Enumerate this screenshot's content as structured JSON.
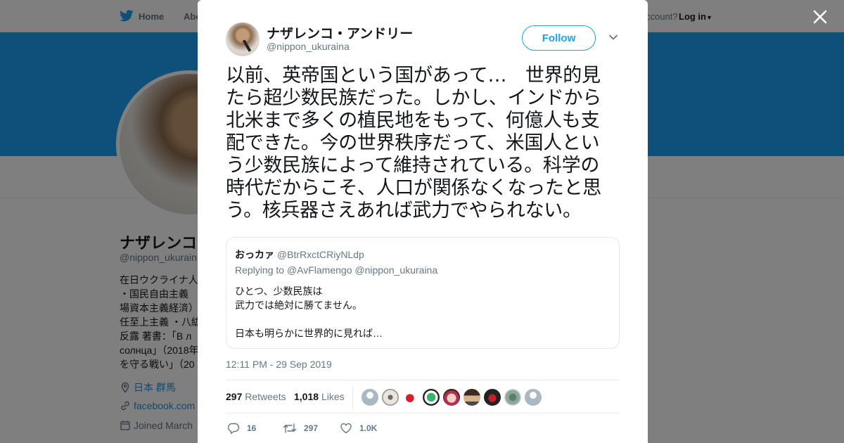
{
  "nav": {
    "home": "Home",
    "about": "Abo",
    "account_prompt": "ccount?",
    "login": "Log in"
  },
  "profile": {
    "name": "ナザレンコ",
    "handle": "@nippon_ukurain",
    "bio_lines": [
      "在日ウクライナ人",
      "・国民自由主義",
      "場資本主義経済）",
      "任至上主義 ・八紘",
      "反露 著書：「В л",
      "солнца」（2018年",
      "を守る戦い」（20"
    ],
    "location": "日本 群馬",
    "url": "facebook.com",
    "joined": "Joined March"
  },
  "tweet": {
    "author_name": "ナザレンコ・アンドリー",
    "author_handle": "@nippon_ukuraina",
    "follow_label": "Follow",
    "text_lines": [
      "以前、英帝国という国があって…　世界的見",
      "たら超少数民族だった。しかし、インドから",
      "北米まで多くの植民地をもって、何億人も支",
      "配できた。今の世界秩序だって、米国人とい",
      "う少数民族によって維持されている。科学の",
      "時代だからこそ、人口が関係なくなったと思",
      "う。核兵器さえあれば武力でやられない。"
    ],
    "quoted": {
      "name": "おっカァ",
      "handle": "@BtrRxctCRiyNLdp",
      "replying_prefix": "Replying to",
      "replying_to": "@AvFlamengo @nippon_ukuraina",
      "body_lines": [
        "ひとつ、少数民族は",
        "武力では絶対に勝てません。",
        "",
        "日本も明らかに世界的に見れば…"
      ]
    },
    "timestamp": "12:11 PM - 29 Sep 2019",
    "retweets_count": "297",
    "retweets_label": "Retweets",
    "likes_count": "1,018",
    "likes_label": "Likes",
    "actions": {
      "replies": "16",
      "retweets": "297",
      "likes": "1.0K"
    }
  },
  "colors": {
    "accent": "#1da1f2",
    "banner": "#1da1f2",
    "secondary_text": "#657786",
    "like_heart": "#e0245e"
  }
}
